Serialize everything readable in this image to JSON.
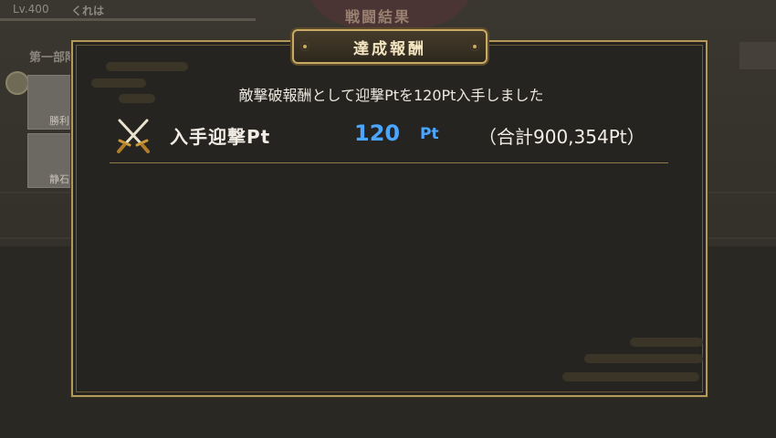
{
  "background": {
    "level": "Lv.400",
    "player_name": "くれは",
    "screen_title": "戦闘結果",
    "section_label": "第一部隊",
    "card_labels": [
      "勝利",
      "静石"
    ]
  },
  "dialog": {
    "title": "達成報酬",
    "message": "敵撃破報酬として迎撃Ptを120Pt入手しました",
    "reward": {
      "icon": "crossed-swords-icon",
      "label": "入手迎撃Pt",
      "value": "120",
      "unit": "Pt",
      "total": "（合計900,354Pt）"
    }
  },
  "colors": {
    "accent_gold": "#b49a5a",
    "value_blue": "#4aa6ff",
    "panel": "#262421"
  }
}
